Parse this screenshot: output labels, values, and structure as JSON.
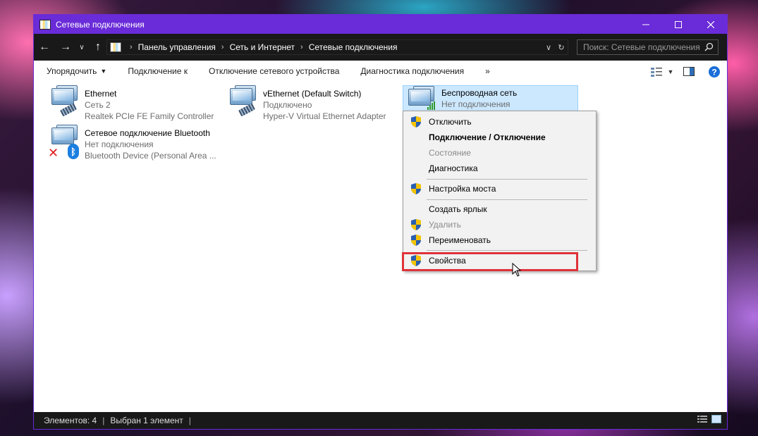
{
  "window": {
    "title": "Сетевые подключения"
  },
  "address": {
    "crumbs": [
      "Панель управления",
      "Сеть и Интернет",
      "Сетевые подключения"
    ],
    "search_placeholder": "Поиск: Сетевые подключения"
  },
  "toolbar": {
    "organize": "Упорядочить",
    "connect_to": "Подключение к",
    "disable_device": "Отключение сетевого устройства",
    "diagnose": "Диагностика подключения",
    "more": "»"
  },
  "connections": [
    {
      "name": "Ethernet",
      "status": "Сеть 2",
      "device": "Realtek PCIe FE Family Controller"
    },
    {
      "name": "vEthernet (Default Switch)",
      "status": "Подключено",
      "device": "Hyper-V Virtual Ethernet Adapter"
    },
    {
      "name": "Беспроводная сеть",
      "status": "Нет подключения",
      "device": ""
    },
    {
      "name": "Сетевое подключение Bluetooth",
      "status": "Нет подключения",
      "device": "Bluetooth Device (Personal Area ..."
    }
  ],
  "context_menu": {
    "items": [
      {
        "label": "Отключить",
        "shield": true,
        "style": "normal"
      },
      {
        "label": "Подключение / Отключение",
        "shield": false,
        "style": "bold"
      },
      {
        "label": "Состояние",
        "shield": false,
        "style": "disabled"
      },
      {
        "label": "Диагностика",
        "shield": false,
        "style": "normal"
      },
      {
        "label": "Настройка моста",
        "shield": true,
        "style": "normal"
      },
      {
        "label": "Создать ярлык",
        "shield": false,
        "style": "normal"
      },
      {
        "label": "Удалить",
        "shield": true,
        "style": "disabled"
      },
      {
        "label": "Переименовать",
        "shield": true,
        "style": "normal"
      },
      {
        "label": "Свойства",
        "shield": true,
        "style": "normal"
      }
    ]
  },
  "status": {
    "items_count": "Элементов: 4",
    "selected": "Выбран 1 элемент"
  },
  "colors": {
    "titlebar": "#6a2bd8",
    "highlight": "#e0323a",
    "selection": "#cce8ff"
  }
}
